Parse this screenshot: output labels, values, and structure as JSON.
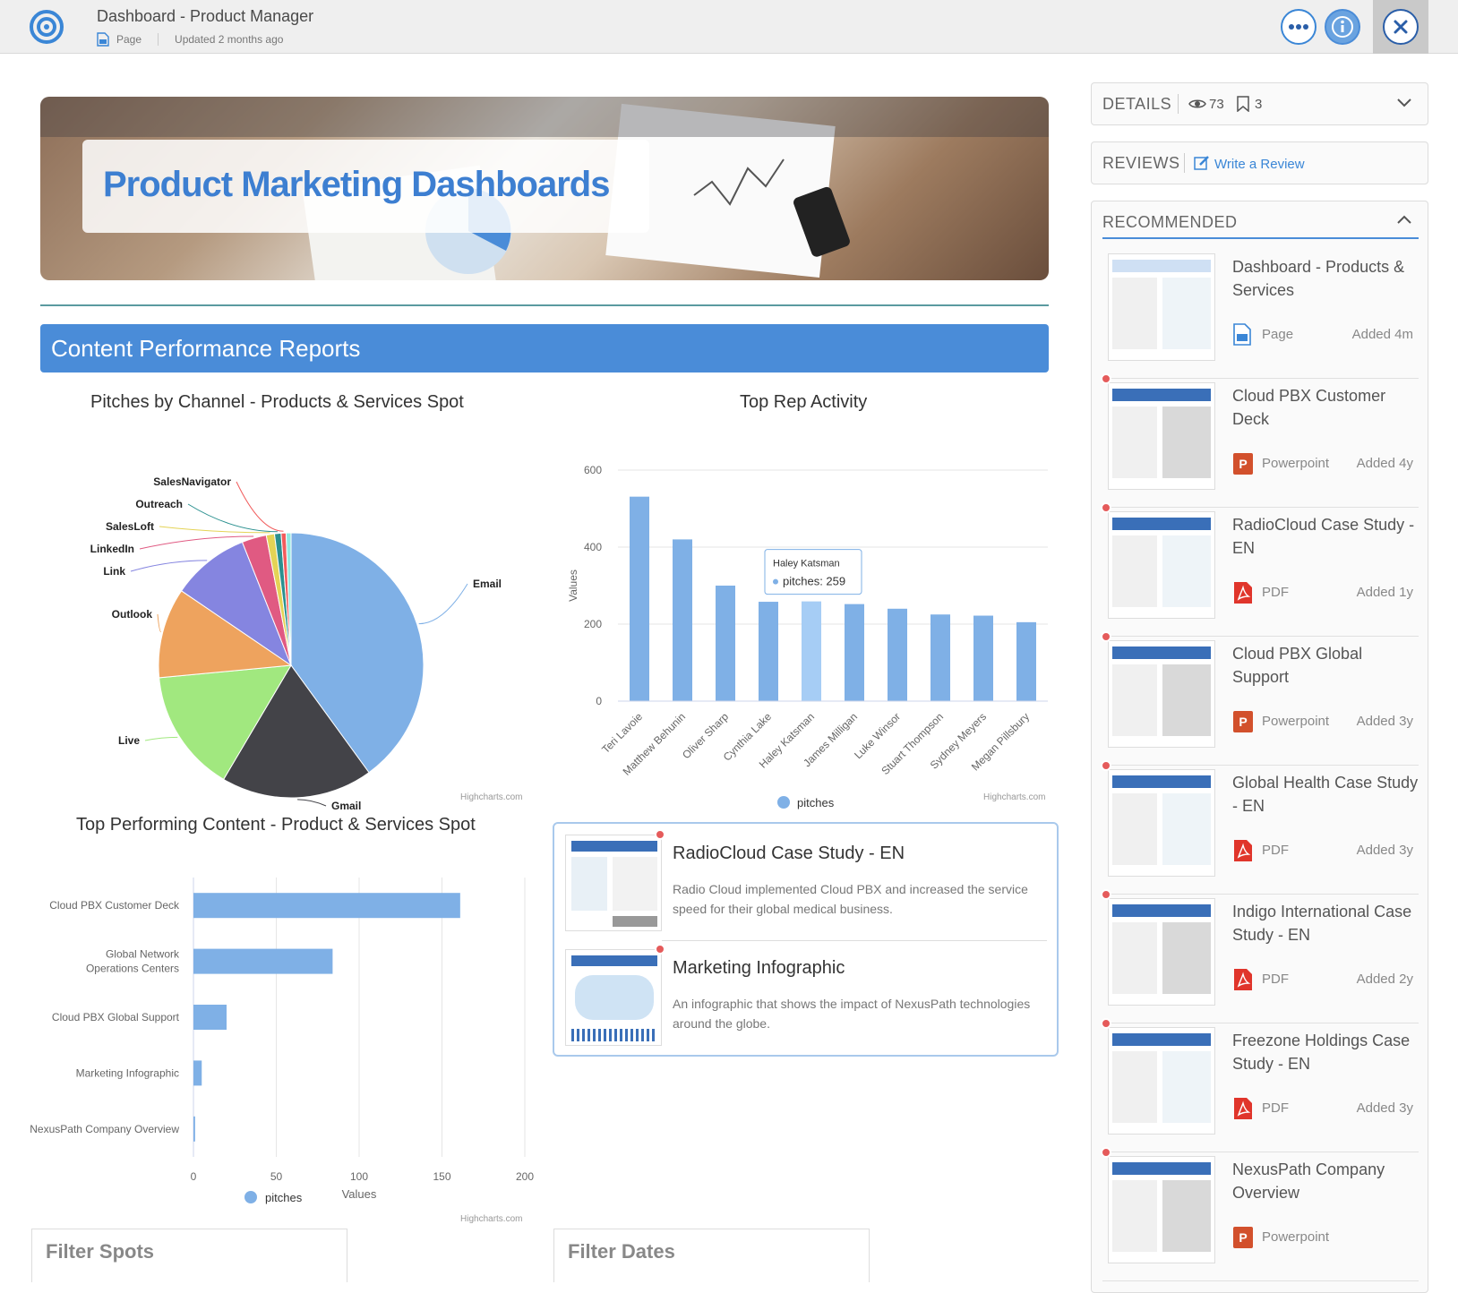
{
  "header": {
    "title": "Dashboard - Product Manager",
    "type_label": "Page",
    "updated": "Updated 2 months ago"
  },
  "hero": {
    "title": "Product Marketing Dashboards"
  },
  "section": {
    "title": "Content Performance Reports"
  },
  "pie": {
    "title": "Pitches by Channel - Products & Services Spot",
    "credit": "Highcharts.com"
  },
  "bar": {
    "title": "Top Rep Activity",
    "credit": "Highcharts.com",
    "tooltip_name": "Haley Katsman",
    "tooltip_value": "pitches: 259"
  },
  "hbar": {
    "title": "Top Performing Content - Product & Services Spot",
    "credit": "Highcharts.com"
  },
  "chart_data": [
    {
      "type": "pie",
      "title": "Pitches by Channel - Products & Services Spot",
      "slices": [
        {
          "name": "Email",
          "value": 40.0,
          "color": "#7fb0e6"
        },
        {
          "name": "Gmail",
          "value": 18.5,
          "color": "#434348"
        },
        {
          "name": "Live",
          "value": 15.0,
          "color": "#a1e87f"
        },
        {
          "name": "Outlook",
          "value": 11.0,
          "color": "#eea35e"
        },
        {
          "name": "Link",
          "value": 9.5,
          "color": "#8585e0"
        },
        {
          "name": "LinkedIn",
          "value": 3.0,
          "color": "#e05a82"
        },
        {
          "name": "SalesLoft",
          "value": 1.0,
          "color": "#e4d356"
        },
        {
          "name": "Outreach",
          "value": 0.8,
          "color": "#2a908f"
        },
        {
          "name": "SalesNavigator",
          "value": 0.6,
          "color": "#f15c5c"
        },
        {
          "name": "",
          "value": 0.6,
          "color": "#91e8e1"
        }
      ]
    },
    {
      "type": "bar",
      "title": "Top Rep Activity",
      "categories": [
        "Teri Lavoie",
        "Matthew Behunin",
        "Oliver Sharp",
        "Cynthia Lake",
        "Haley Katsman",
        "James Milligan",
        "Luke Winsor",
        "Stuart Thompson",
        "Sydney Meyers",
        "Megan Pillsbury"
      ],
      "series": [
        {
          "name": "pitches",
          "values": [
            531,
            420,
            300,
            258,
            259,
            252,
            240,
            225,
            222,
            205
          ]
        }
      ],
      "ylabel": "Values",
      "ylim": [
        0,
        600
      ],
      "yticks": [
        "0",
        "200",
        "400",
        "600"
      ],
      "legend": "pitches",
      "highlight_index": 4,
      "color": "#7fb0e6",
      "highlight_color": "#a6cdf5"
    },
    {
      "type": "bar",
      "orientation": "horizontal",
      "title": "Top Performing Content - Product & Services Spot",
      "categories": [
        "Cloud PBX Customer Deck",
        "Global Network Operations Centers",
        "Cloud PBX Global Support",
        "Marketing Infographic",
        "NexusPath Company Overview"
      ],
      "series": [
        {
          "name": "pitches",
          "values": [
            161,
            84,
            20,
            5,
            1
          ]
        }
      ],
      "xlabel": "Values",
      "xlim": [
        0,
        200
      ],
      "xticks": [
        "0",
        "50",
        "100",
        "150",
        "200"
      ],
      "legend": "pitches",
      "color": "#7fb0e6"
    }
  ],
  "content_card": {
    "items": [
      {
        "title": "RadioCloud Case Study - EN",
        "desc": "Radio Cloud implemented Cloud PBX and increased the service speed for their global medical business."
      },
      {
        "title": "Marketing Infographic",
        "desc": "An infographic that shows the impact of NexusPath technologies around the globe."
      }
    ]
  },
  "filters": {
    "spots": "Filter Spots",
    "dates": "Filter Dates"
  },
  "sidebar": {
    "details": {
      "label": "DETAILS",
      "views": "73",
      "bookmarks": "3"
    },
    "reviews": {
      "label": "REVIEWS",
      "write": "Write a Review"
    },
    "recommended": {
      "label": "RECOMMENDED",
      "items": [
        {
          "title": "Dashboard - Products & Services",
          "type": "Page",
          "added": "Added 4m",
          "icon": "page-icon",
          "new": false
        },
        {
          "title": "Cloud PBX Customer Deck",
          "type": "Powerpoint",
          "added": "Added 4y",
          "icon": "powerpoint-icon",
          "new": true
        },
        {
          "title": "RadioCloud Case Study - EN",
          "type": "PDF",
          "added": "Added 1y",
          "icon": "pdf-icon",
          "new": true
        },
        {
          "title": "Cloud PBX Global Support",
          "type": "Powerpoint",
          "added": "Added 3y",
          "icon": "powerpoint-icon",
          "new": true
        },
        {
          "title": "Global Health Case Study - EN",
          "type": "PDF",
          "added": "Added 3y",
          "icon": "pdf-icon",
          "new": true
        },
        {
          "title": "Indigo International Case Study - EN",
          "type": "PDF",
          "added": "Added 2y",
          "icon": "pdf-icon",
          "new": true
        },
        {
          "title": "Freezone Holdings Case Study - EN",
          "type": "PDF",
          "added": "Added 3y",
          "icon": "pdf-icon",
          "new": true
        },
        {
          "title": "NexusPath Company Overview",
          "type": "Powerpoint",
          "added": "",
          "icon": "powerpoint-icon",
          "new": true
        }
      ]
    }
  }
}
